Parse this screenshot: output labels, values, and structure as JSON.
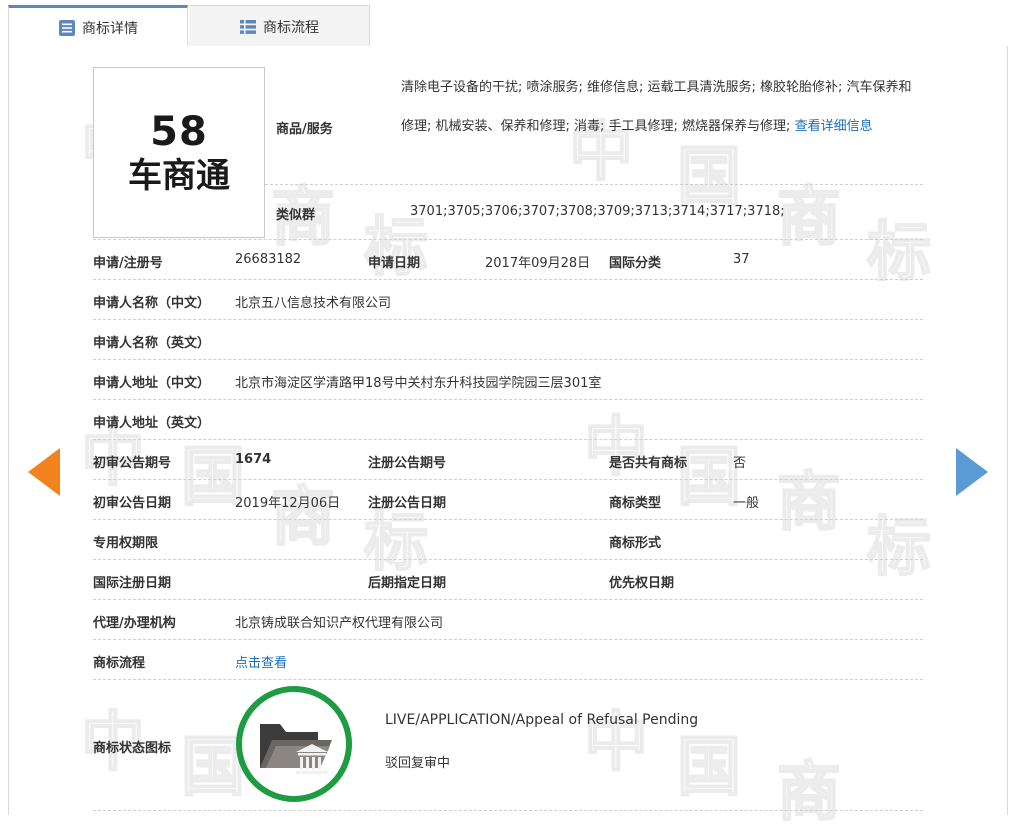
{
  "tabs": [
    {
      "label": "商标详情",
      "active": true
    },
    {
      "label": "商标流程",
      "active": false
    }
  ],
  "logo": {
    "line1": "58",
    "line2": "车商通"
  },
  "goods": {
    "label": "商品/服务",
    "text": "清除电子设备的干扰; 喷涂服务; 维修信息; 运载工具清洗服务; 橡胶轮胎修补; 汽车保养和修理; 机械安装、保养和修理; 消毒; 手工具修理; 燃烧器保养与修理; ",
    "more_link": "查看详细信息"
  },
  "similar_group": {
    "label": "类似群",
    "value": "3701;3705;3706;3707;3708;3709;3713;3714;3717;3718;"
  },
  "fields": {
    "reg_no_label": "申请/注册号",
    "reg_no": "26683182",
    "apply_date_label": "申请日期",
    "apply_date": "2017年09月28日",
    "intl_class_label": "国际分类",
    "intl_class": "37",
    "applicant_cn_label": "申请人名称（中文）",
    "applicant_cn": "北京五八信息技术有限公司",
    "applicant_en_label": "申请人名称（英文）",
    "applicant_en": "",
    "address_cn_label": "申请人地址（中文）",
    "address_cn": "北京市海淀区学清路甲18号中关村东升科技园学院园三层301室",
    "address_en_label": "申请人地址（英文）",
    "address_en": "",
    "prelim_issue_label": "初审公告期号",
    "prelim_issue": "1674",
    "reg_issue_label": "注册公告期号",
    "reg_issue": "",
    "shared_label": "是否共有商标",
    "shared": "否",
    "prelim_date_label": "初审公告日期",
    "prelim_date": "2019年12月06日",
    "reg_date_label": "注册公告日期",
    "reg_date": "",
    "mark_type_label": "商标类型",
    "mark_type": "一般",
    "exclusive_period_label": "专用权期限",
    "exclusive_period": "",
    "mark_form_label": "商标形式",
    "mark_form": "",
    "intl_reg_date_label": "国际注册日期",
    "intl_reg_date": "",
    "later_designation_label": "后期指定日期",
    "later_designation": "",
    "priority_date_label": "优先权日期",
    "priority_date": "",
    "agent_label": "代理/办理机构",
    "agent": "北京铸成联合知识产权代理有限公司",
    "process_label": "商标流程",
    "process_link": "点击查看",
    "status_icon_label": "商标状态图标",
    "status_en": "LIVE/APPLICATION/Appeal of Refusal Pending",
    "status_cn": "驳回复审中"
  },
  "watermark": {
    "text": [
      "中",
      "国",
      "商",
      "标"
    ]
  },
  "colors": {
    "tab_active_border": "#5f87bf",
    "link": "#1a6fba",
    "prev_arrow": "#f4821f",
    "next_arrow": "#5c9ad6",
    "status_ring": "#1f9b43"
  },
  "icons": {
    "prev": "arrow-left-icon",
    "next": "arrow-right-icon",
    "details_tab": "document-list-icon",
    "flow_tab": "list-grid-icon",
    "status": "folder-courthouse-icon"
  }
}
